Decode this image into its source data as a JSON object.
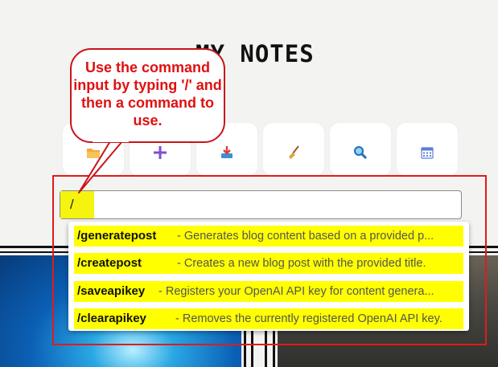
{
  "page": {
    "title": "MY NOTES"
  },
  "toolbar": {
    "buttons": [
      {
        "name": "folder-icon"
      },
      {
        "name": "plus-icon"
      },
      {
        "name": "download-icon"
      },
      {
        "name": "broom-icon"
      },
      {
        "name": "search-icon"
      },
      {
        "name": "calendar-icon"
      }
    ]
  },
  "command_input": {
    "value": "/"
  },
  "commands": [
    {
      "name": "/generatepost",
      "description": "- Generates blog content based on a provided p..."
    },
    {
      "name": "/createpost",
      "description": "- Creates a new blog post with the provided title."
    },
    {
      "name": "/saveapikey",
      "description": "- Registers your OpenAI API key for content genera..."
    },
    {
      "name": "/clearapikey",
      "description": "- Removes the currently registered OpenAI API key."
    }
  ],
  "callout": {
    "text": "Use the command input by typing '/' and then a command to use."
  },
  "colors": {
    "highlight_yellow": "#ffff00",
    "annotation_red": "#e01b1b",
    "callout_text": "#e01010"
  }
}
